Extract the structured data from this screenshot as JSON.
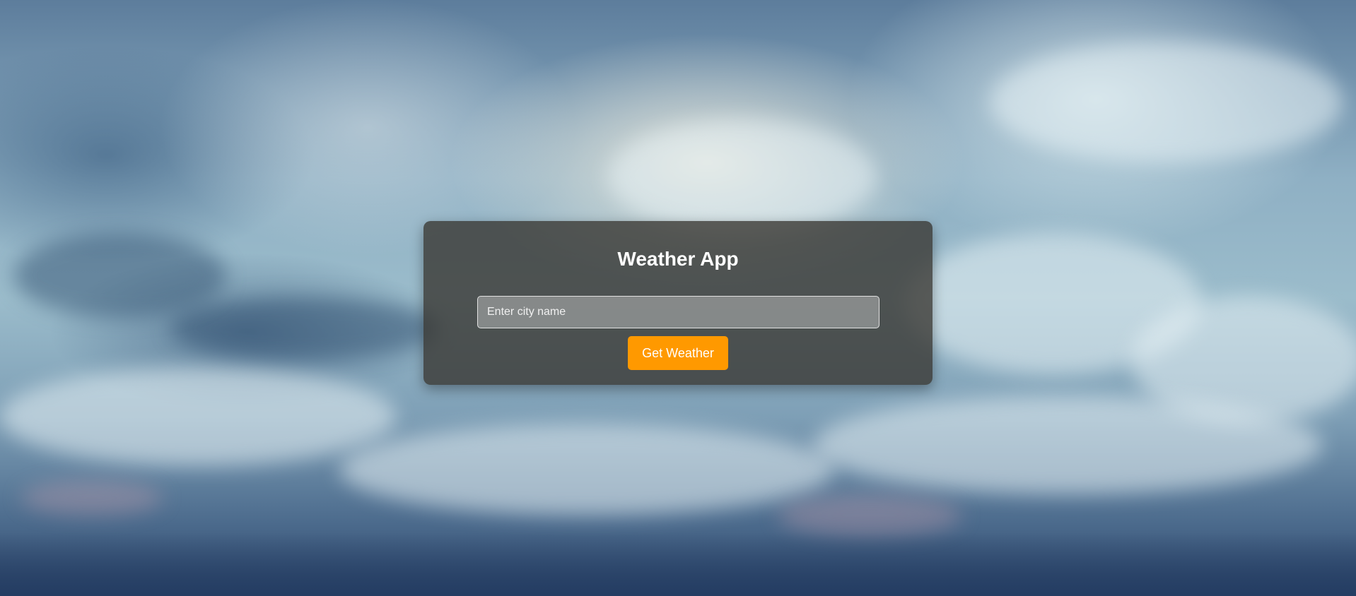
{
  "page": {
    "background": "cloudy-sky"
  },
  "card": {
    "title": "Weather App",
    "city_input": {
      "value": "",
      "placeholder": "Enter city name"
    },
    "submit_label": "Get Weather"
  },
  "colors": {
    "accent": "#ff9900",
    "card_bg": "#37342f",
    "text": "#ffffff"
  }
}
